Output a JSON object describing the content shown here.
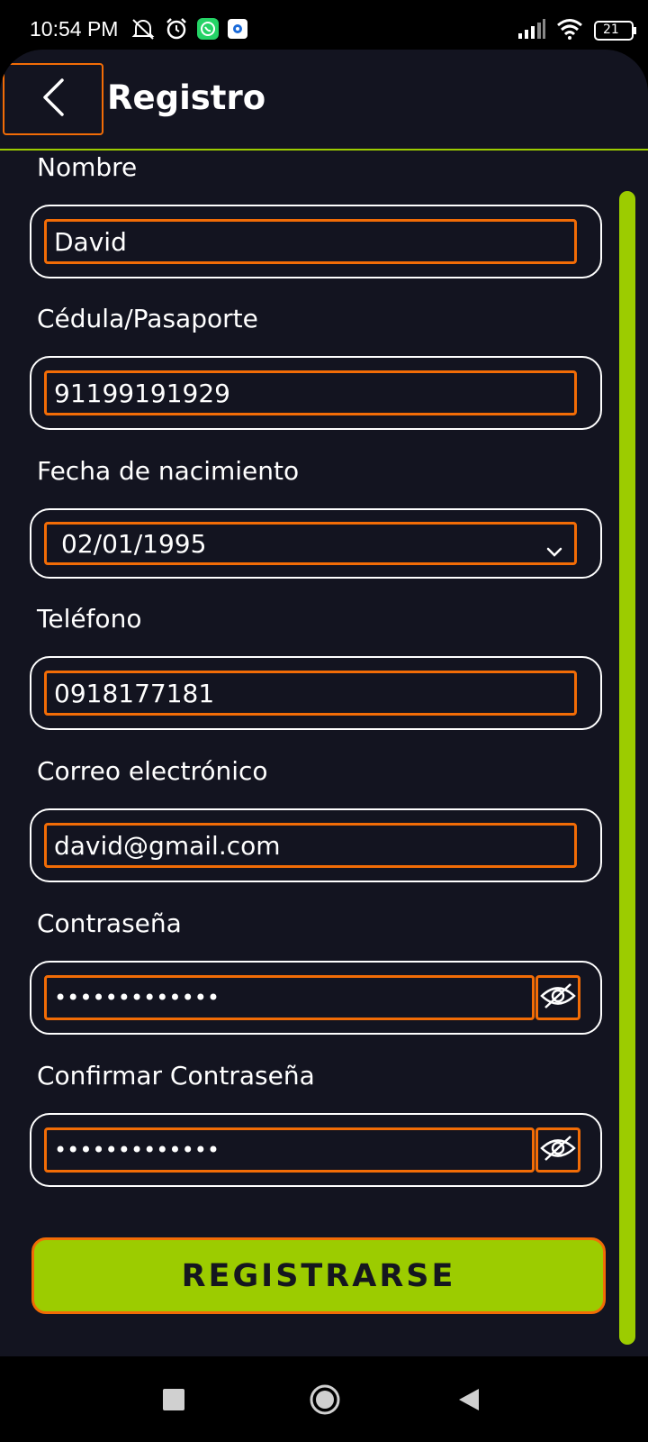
{
  "status_bar": {
    "time": "10:54 PM",
    "battery": "21",
    "icons_left": [
      "mute-alarm-icon",
      "alarm-clock-icon",
      "whatsapp-icon",
      "app-notification-icon"
    ],
    "icons_right": [
      "signal-icon",
      "wifi-icon",
      "battery-icon"
    ]
  },
  "header": {
    "back_icon": "chevron-left-icon",
    "title": "Registro"
  },
  "form": {
    "nombre": {
      "label": "Nombre",
      "value": "David"
    },
    "cedula": {
      "label": "Cédula/Pasaporte",
      "value": "91199191929"
    },
    "fecha": {
      "label": "Fecha de nacimiento",
      "value": "02/01/1995"
    },
    "telefono": {
      "label": "Teléfono",
      "value": "0918177181"
    },
    "correo": {
      "label": "Correo electrónico",
      "value": "david@gmail.com"
    },
    "contrasena": {
      "label": "Contraseña",
      "value": "•••••••••••••"
    },
    "confirmar": {
      "label": "Confirmar Contraseña",
      "value": "•••••••••••••"
    }
  },
  "actions": {
    "register_label": "REGISTRARSE"
  },
  "colors": {
    "background": "#131420",
    "accent": "#9ccc00",
    "highlight": "#f26c06",
    "text": "#ffffff"
  },
  "nav_bar": {
    "items": [
      "recents-square-icon",
      "home-circle-icon",
      "back-triangle-icon"
    ]
  }
}
